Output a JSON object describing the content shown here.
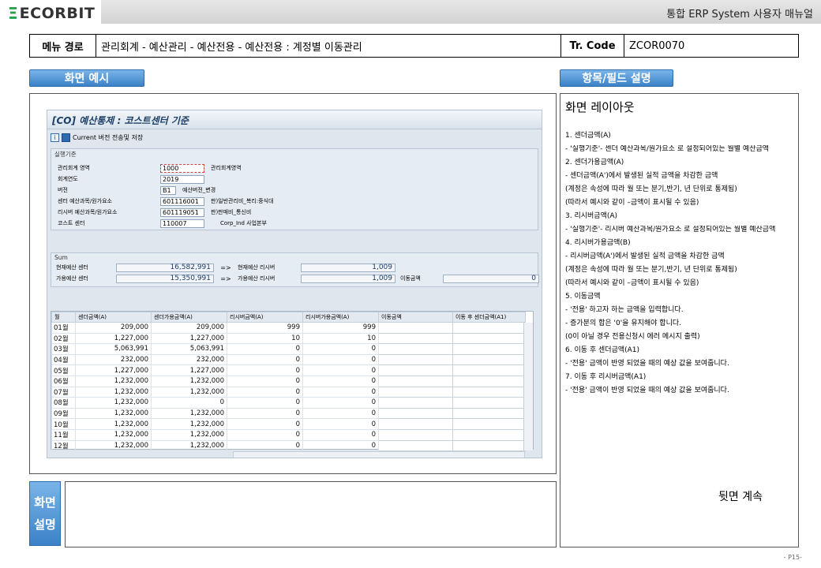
{
  "header": {
    "logo_mark": "Ξ",
    "logo_text": "ECORBIT",
    "manual_title": "통합 ERP System 사용자 매뉴얼"
  },
  "path_row": {
    "menu_label": "메뉴 경로",
    "menu_path": "관리회계 - 예산관리 - 예산전용 - 예산전용 : 계정별 이동관리",
    "code_label": "Tr. Code",
    "code": "ZCOR0070"
  },
  "tabs": {
    "screen_example": "화면 예시",
    "field_desc": "항목/필드 설명"
  },
  "sap": {
    "title": "[CO] 예산통제 : 코스트센터 기준",
    "toolbar_text": "Current 버전 전송및 저장",
    "toolbar_info_icon": "i",
    "criteria": {
      "group_title": "실행기준",
      "rows": [
        {
          "label": "관리회계 영역",
          "value": "1000",
          "desc": "관리회계영역"
        },
        {
          "label": "회계연도",
          "value": "2019",
          "desc": ""
        },
        {
          "label": "버전",
          "value": "B1",
          "desc": "예산버전_변경"
        },
        {
          "label": "센터 예산과목/원가요소",
          "value": "601116001",
          "desc": "판)일반관리비_복리:중식대"
        },
        {
          "label": "리시버 예산과목/원가요소",
          "value": "601119051",
          "desc": "판)판매비_통신비"
        },
        {
          "label": "코스트 센터",
          "value": "110007",
          "desc": "Corp_Ind 사업본부"
        }
      ]
    },
    "sum": {
      "group_title": "Sum",
      "row1": {
        "label": "현재예산 센터",
        "value": "16,582,991",
        "arrow": "=>",
        "label2": "현재예산 리시버",
        "value2": "1,009"
      },
      "row2": {
        "label": "가용예산 센터",
        "value": "15,350,991",
        "arrow": "=>",
        "label2": "가용예산 리시버",
        "value2": "1,009",
        "label3": "이동금액",
        "value3": "0"
      }
    },
    "grid": {
      "columns": [
        "월",
        "센더금액(A)",
        "센더가용금액(A)",
        "리시버금액(A)",
        "리시버가용금액(A)",
        "이동금액",
        "이동 후 센더금액(A1)"
      ],
      "rows": [
        [
          "01월",
          "209,000",
          "209,000",
          "999",
          "999",
          "",
          ""
        ],
        [
          "02월",
          "1,227,000",
          "1,227,000",
          "10",
          "10",
          "",
          ""
        ],
        [
          "03월",
          "5,063,991",
          "5,063,991",
          "0",
          "0",
          "",
          ""
        ],
        [
          "04월",
          "232,000",
          "232,000",
          "0",
          "0",
          "",
          ""
        ],
        [
          "05월",
          "1,227,000",
          "1,227,000",
          "0",
          "0",
          "",
          ""
        ],
        [
          "06월",
          "1,232,000",
          "1,232,000",
          "0",
          "0",
          "",
          ""
        ],
        [
          "07월",
          "1,232,000",
          "1,232,000",
          "0",
          "0",
          "",
          ""
        ],
        [
          "08월",
          "1,232,000",
          "0",
          "0",
          "0",
          "",
          ""
        ],
        [
          "09월",
          "1,232,000",
          "1,232,000",
          "0",
          "0",
          "",
          ""
        ],
        [
          "10월",
          "1,232,000",
          "1,232,000",
          "0",
          "0",
          "",
          ""
        ],
        [
          "11월",
          "1,232,000",
          "1,232,000",
          "0",
          "0",
          "",
          ""
        ],
        [
          "12월",
          "1,232,000",
          "1,232,000",
          "0",
          "0",
          "",
          ""
        ]
      ]
    }
  },
  "desc": {
    "title": "화면 레이아웃",
    "lines": [
      "1.    센더금액(A)",
      "  - '실행기준'- 센더 예산과목/원가요소 로 설정되어있는 월별 예산금액",
      "2.  센더가용금액(A)",
      "  - 센더금액(A')에서 발생된 실적 금액을 차감한 금액",
      " (계정은 속성에 따라 월 또는 분기,반기, 년 단위로 통제됨)",
      " (따라서 예시와 같이 –금액이 표시될 수 있음)",
      "3.  리시버금액(A)",
      "  - '실행기준'- 리시버 예산과목/원가요소 로 설정되어있는 월별 예산금액",
      "4.    리시버가용금액(B)",
      " - 리시버금액(A')에서 발생된 실적 금액을 차감한 금액",
      " (계정은 속성에 따라 월 또는 분기,반기, 년 단위로 통제됨)",
      " (따라서 예시와 같이 –금액이 표시될 수 있음)",
      "5. 이동금액",
      "  - '전용' 하고자 하는 금액을 입력합니다.",
      "  - 증가분의 합은 '0'을 유지해야 합니다.",
      "   (0이 아닐 경우 전용신청시 에러 메시지 출력)",
      "6.  이동 후 센더금액(A1)",
      "  - '전용' 금액이 반영 되었을 때의 예상 값을 보여줍니다.",
      "7. 이동 후 리시버금액(A1)",
      "  - '전용' 금액이 반영 되었을 때의 예상 값을 보여줍니다."
    ],
    "continued": "뒷면 계속"
  },
  "explanation": {
    "label_line1": "화면",
    "label_line2": "설명"
  },
  "page_number": "- P15-"
}
